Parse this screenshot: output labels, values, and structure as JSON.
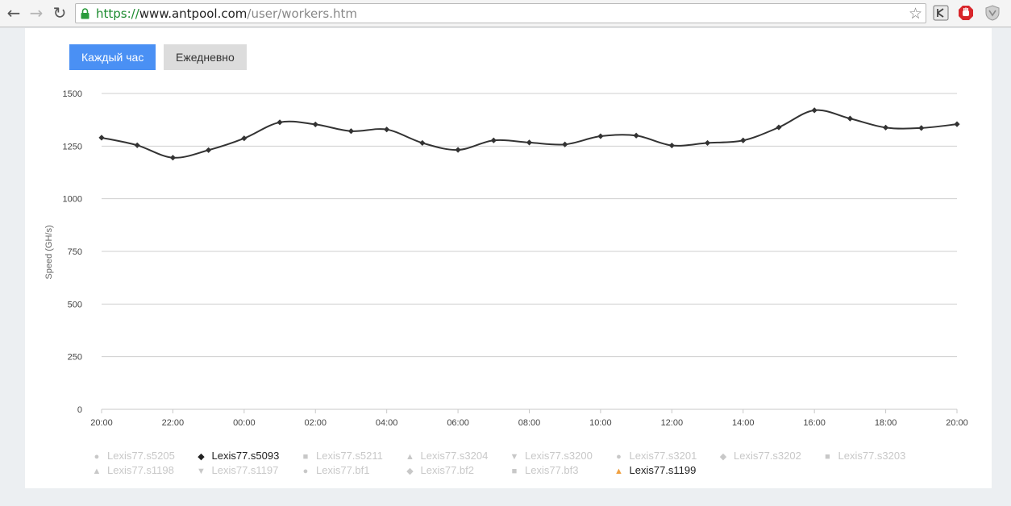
{
  "browser": {
    "url_scheme": "https://",
    "url_host": "www.antpool.com",
    "url_path": "/user/workers.htm",
    "back_icon": "←",
    "forward_icon": "→",
    "reload_icon": "↻",
    "star_icon": "☆"
  },
  "tabs": {
    "hourly_label": "Каждый час",
    "daily_label": "Ежедневно"
  },
  "chart_data": {
    "type": "line",
    "ylabel": "Speed (GH/s)",
    "ylim": [
      0,
      1500
    ],
    "yticks": [
      "0",
      "250",
      "500",
      "750",
      "1000",
      "1250",
      "1500"
    ],
    "xticks": [
      "20:00",
      "22:00",
      "00:00",
      "02:00",
      "04:00",
      "06:00",
      "08:00",
      "10:00",
      "12:00",
      "14:00",
      "16:00",
      "18:00",
      "20:00"
    ],
    "grid": true,
    "legend_placement": "bottom",
    "series": [
      {
        "name": "Lexis77.s5093",
        "color": "#333333",
        "values": [
          1290,
          1254,
          1195,
          1231,
          1287,
          1363,
          1353,
          1321,
          1329,
          1265,
          1232,
          1277,
          1267,
          1258,
          1297,
          1300,
          1253,
          1265,
          1277,
          1339,
          1420,
          1381,
          1338,
          1336,
          1354
        ]
      }
    ],
    "legend": [
      {
        "name": "Lexis77.s5205",
        "marker": "●",
        "active": false
      },
      {
        "name": "Lexis77.s5093",
        "marker": "◆",
        "active": true
      },
      {
        "name": "Lexis77.s5211",
        "marker": "■",
        "active": false
      },
      {
        "name": "Lexis77.s3204",
        "marker": "▲",
        "active": false
      },
      {
        "name": "Lexis77.s3200",
        "marker": "▼",
        "active": false
      },
      {
        "name": "Lexis77.s3201",
        "marker": "●",
        "active": false
      },
      {
        "name": "Lexis77.s3202",
        "marker": "◆",
        "active": false
      },
      {
        "name": "Lexis77.s3203",
        "marker": "■",
        "active": false
      },
      {
        "name": "Lexis77.s1198",
        "marker": "▲",
        "active": false
      },
      {
        "name": "Lexis77.s1197",
        "marker": "▼",
        "active": false
      },
      {
        "name": "Lexis77.bf1",
        "marker": "●",
        "active": false
      },
      {
        "name": "Lexis77.bf2",
        "marker": "◆",
        "active": false
      },
      {
        "name": "Lexis77.bf3",
        "marker": "■",
        "active": false
      },
      {
        "name": "Lexis77.s1199",
        "marker": "▲",
        "active": true,
        "color": "#f0a040"
      }
    ]
  }
}
